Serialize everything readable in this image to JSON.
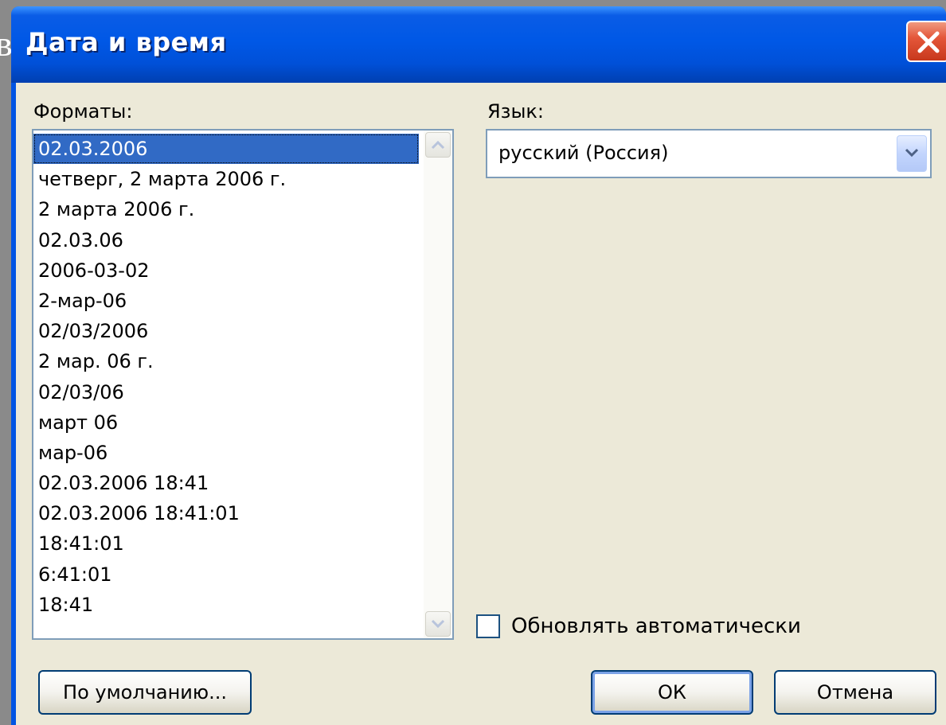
{
  "window": {
    "title": "Дата и время",
    "backdrop_text": "в"
  },
  "formats": {
    "label": "Форматы:",
    "items": [
      "02.03.2006",
      "четверг, 2 марта 2006 г.",
      "2 марта 2006 г.",
      "02.03.06",
      "2006-03-02",
      "2-мар-06",
      "02/03/2006",
      "2 мар. 06 г.",
      "02/03/06",
      "март 06",
      "мар-06",
      "02.03.2006 18:41",
      "02.03.2006 18:41:01",
      "18:41:01",
      "6:41:01",
      "18:41"
    ],
    "selected_index": 0
  },
  "language": {
    "label": "Язык:",
    "value": "русский (Россия)"
  },
  "auto_update": {
    "label": "Обновлять автоматически",
    "checked": false
  },
  "buttons": {
    "default": "По умолчанию...",
    "ok": "ОК",
    "cancel": "Отмена"
  },
  "colors": {
    "titlebar": "#0058e6",
    "selection": "#316ac5",
    "dialog_bg": "#ece9d8",
    "close": "#e4573a"
  }
}
